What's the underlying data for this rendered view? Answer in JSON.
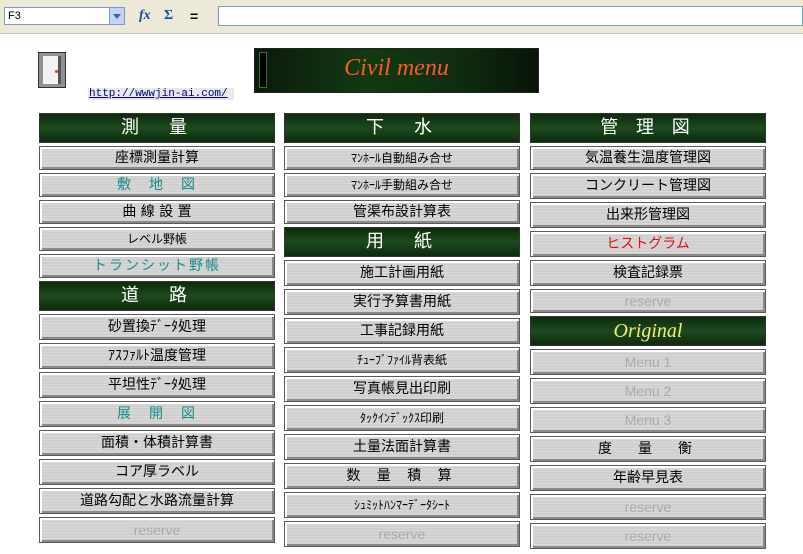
{
  "formula_bar": {
    "name_box": "F3",
    "fx_icon": "fx",
    "sum_icon": "Σ",
    "equals": "=",
    "formula": ""
  },
  "header": {
    "title": "Civil menu",
    "link": "http://wwwjin-ai.com/"
  },
  "columns": [
    {
      "sections": [
        {
          "title": "測　量",
          "items": [
            "座標測量計算",
            "敷　地　図",
            "曲 線 設 置",
            "レベル野帳",
            "トランシット野帳"
          ]
        },
        {
          "title": "道　路",
          "items": [
            "砂置換ﾃﾞｰﾀ処理",
            "ｱｽﾌｧﾙﾄ温度管理",
            "平坦性ﾃﾞｰﾀ処理",
            "展　開　図",
            "面積・体積計算書",
            "コア厚ラベル",
            "道路勾配と水路流量計算",
            "reserve"
          ]
        }
      ]
    },
    {
      "sections": [
        {
          "title": "下　水",
          "items": [
            "ﾏﾝﾎｰﾙ自動組み合せ",
            "ﾏﾝﾎｰﾙ手動組み合せ",
            "管渠布設計算表"
          ]
        },
        {
          "title": "用　紙",
          "items": [
            "施工計画用紙",
            "実行予算書用紙",
            "工事記録用紙",
            "ﾁｭｰﾌﾞﾌｧｲﾙ背表紙",
            "写真帳見出印刷",
            "ﾀｯｸｲﾝﾃﾞｯｸｽ印刷",
            "土量法面計算書",
            "数 量 積 算",
            "ｼｭﾐｯﾄﾊﾝﾏｰﾃﾞｰﾀｼｰﾄ",
            "reserve"
          ]
        }
      ]
    },
    {
      "sections": [
        {
          "title": "管 理 図",
          "items": [
            "気温養生温度管理図",
            "コンクリート管理図",
            "出来形管理図",
            "ヒストグラム",
            "検査記録票",
            "reserve"
          ]
        },
        {
          "title": "Original",
          "items": [
            "Menu 1",
            "Menu 2",
            "Menu 3",
            "度　量　衡",
            "年齢早見表",
            "reserve",
            "reserve"
          ]
        }
      ]
    }
  ]
}
